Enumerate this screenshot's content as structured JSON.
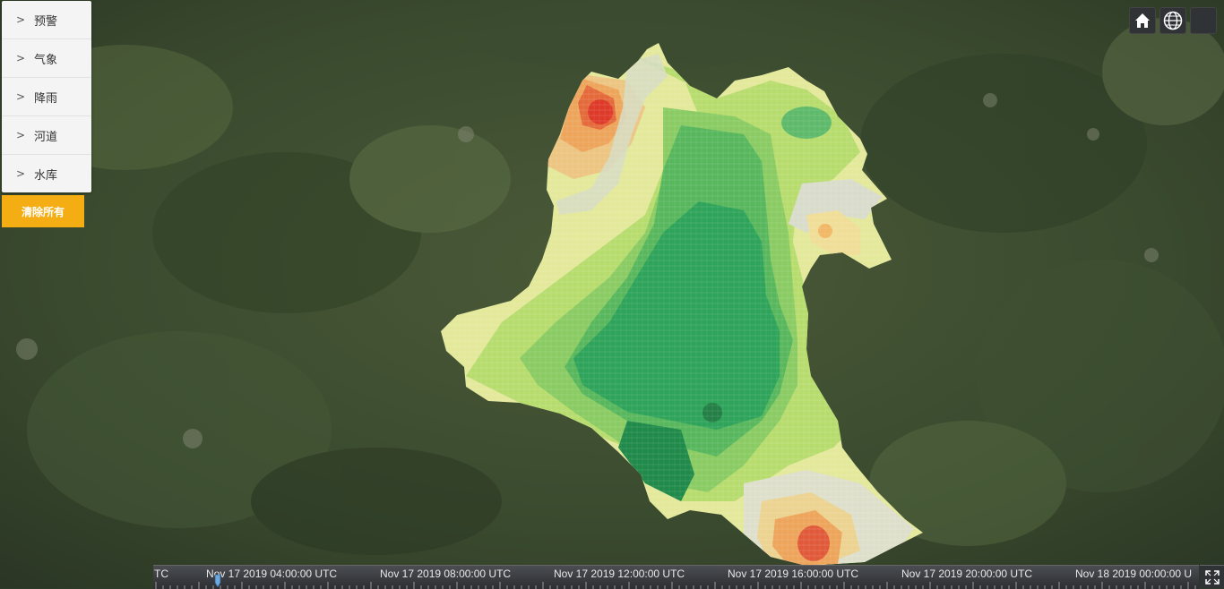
{
  "menu": {
    "items": [
      {
        "label": "预警"
      },
      {
        "label": "气象"
      },
      {
        "label": "降雨"
      },
      {
        "label": "河道"
      },
      {
        "label": "水库"
      }
    ],
    "clear_label": "清除所有"
  },
  "toolbar": {
    "home_icon": "home-icon",
    "globe_icon": "globe-icon",
    "layers_icon": "layers-icon"
  },
  "timeline": {
    "partial_left": "TC",
    "labels": [
      "Nov 17 2019 04:00:00 UTC",
      "Nov 17 2019 08:00:00 UTC",
      "Nov 17 2019 12:00:00 UTC",
      "Nov 17 2019 16:00:00 UTC",
      "Nov 17 2019 20:00:00 UTC",
      "Nov 18 2019 00:00:00 U"
    ]
  },
  "colors": {
    "menu_bg": "#f4f4f4",
    "clear_button": "#f5ad14",
    "toolbar_bg": "#303336",
    "rain_high": "#e8452c",
    "rain_mid": "#f1b15a",
    "rain_low": "#d8e6a0",
    "rain_green": "#2ea35a"
  }
}
